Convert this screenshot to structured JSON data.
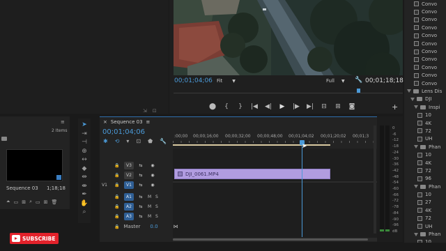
{
  "program_monitor": {
    "timecode_current": "00;01;04;06",
    "zoom": "Fit",
    "quality": "Full",
    "timecode_duration": "00;01;18;18"
  },
  "project_panel": {
    "items_count": "2 Items",
    "sequence_name": "Sequence 03",
    "sequence_duration": "1;18;18"
  },
  "timeline": {
    "tab_label": "Sequence 03",
    "timecode": "00;01;04;06",
    "ruler_ticks": [
      ":00;00",
      "00;00;16;00",
      "00;00;32;00",
      "00;00;48;00",
      "00;01;04;02",
      "00;01;20;02",
      "00;01;3"
    ],
    "video_tracks": [
      {
        "source": "",
        "name": "V3"
      },
      {
        "source": "",
        "name": "V2"
      },
      {
        "source": "V1",
        "name": "V1"
      }
    ],
    "audio_tracks": [
      {
        "name": "A1",
        "m": "M",
        "s": "S"
      },
      {
        "name": "A2",
        "m": "M",
        "s": "S"
      },
      {
        "name": "A3",
        "m": "M",
        "s": "S"
      }
    ],
    "master_label": "Master",
    "master_value": "0.0",
    "clip_name": "DJI_0061.MP4"
  },
  "audio_meter": {
    "scale": [
      "0",
      "-6",
      "-12",
      "-18",
      "-24",
      "-30",
      "-36",
      "-42",
      "-48",
      "-54",
      "-60",
      "-66",
      "-72",
      "-78",
      "-84",
      "-90",
      "-96",
      "dB"
    ]
  },
  "effects_panel": {
    "items": [
      {
        "indent": 4,
        "type": "file",
        "label": "Convo"
      },
      {
        "indent": 4,
        "type": "file",
        "label": "Convo"
      },
      {
        "indent": 4,
        "type": "file",
        "label": "Convo"
      },
      {
        "indent": 4,
        "type": "file",
        "label": "Convo"
      },
      {
        "indent": 4,
        "type": "file",
        "label": "Convo"
      },
      {
        "indent": 4,
        "type": "file",
        "label": "Convo"
      },
      {
        "indent": 4,
        "type": "file",
        "label": "Convo"
      },
      {
        "indent": 4,
        "type": "file",
        "label": "Convo"
      },
      {
        "indent": 4,
        "type": "file",
        "label": "Convo"
      },
      {
        "indent": 4,
        "type": "file",
        "label": "Convo"
      },
      {
        "indent": 4,
        "type": "file",
        "label": "Convo"
      },
      {
        "indent": 2,
        "type": "folder",
        "label": "Lens Dis"
      },
      {
        "indent": 3,
        "type": "folder",
        "label": "DJI"
      },
      {
        "indent": 4,
        "type": "folder",
        "label": "Inspi"
      },
      {
        "indent": 5,
        "type": "file",
        "label": "10"
      },
      {
        "indent": 5,
        "type": "file",
        "label": "4K"
      },
      {
        "indent": 5,
        "type": "file",
        "label": "72"
      },
      {
        "indent": 5,
        "type": "file",
        "label": "UH"
      },
      {
        "indent": 4,
        "type": "folder",
        "label": "Phan"
      },
      {
        "indent": 5,
        "type": "file",
        "label": "10"
      },
      {
        "indent": 5,
        "type": "file",
        "label": "4K"
      },
      {
        "indent": 5,
        "type": "file",
        "label": "72"
      },
      {
        "indent": 5,
        "type": "file",
        "label": "96"
      },
      {
        "indent": 4,
        "type": "folder",
        "label": "Phan"
      },
      {
        "indent": 5,
        "type": "file",
        "label": "10"
      },
      {
        "indent": 5,
        "type": "file",
        "label": "27"
      },
      {
        "indent": 5,
        "type": "file",
        "label": "4K"
      },
      {
        "indent": 5,
        "type": "file",
        "label": "72"
      },
      {
        "indent": 5,
        "type": "file",
        "label": "UH"
      },
      {
        "indent": 4,
        "type": "folder",
        "label": "Phan"
      },
      {
        "indent": 5,
        "type": "file",
        "label": "10"
      }
    ]
  },
  "subscribe_label": "SUBSCRIBE",
  "colors": {
    "accent_blue": "#4b9ad8",
    "clip_purple": "#b19ce0",
    "subscribe_red": "#e3222b"
  }
}
